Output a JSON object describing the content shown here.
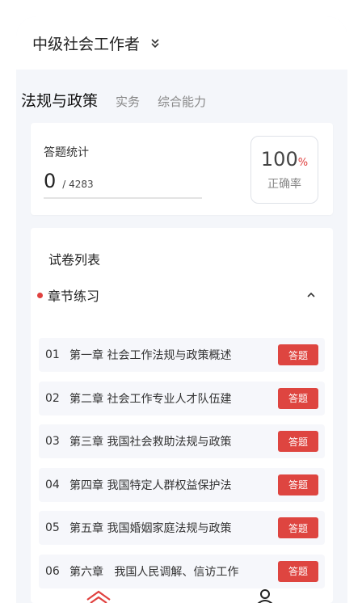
{
  "header": {
    "title": "中级社会工作者"
  },
  "tabs": [
    {
      "label": "法规与政策",
      "active": true
    },
    {
      "label": "实务",
      "active": false
    },
    {
      "label": "综合能力",
      "active": false
    }
  ],
  "stats": {
    "label": "答题统计",
    "answered": "0",
    "total": "/ 4283",
    "accuracy_value": "100",
    "accuracy_symbol": "%",
    "accuracy_label": "正确率"
  },
  "list": {
    "title": "试卷列表",
    "section": "章节练习",
    "items": [
      {
        "no": "01",
        "text": "第一章 社会工作法规与政策概述",
        "button": "答题"
      },
      {
        "no": "02",
        "text": "第二章 社会工作专业人才队伍建",
        "button": "答题"
      },
      {
        "no": "03",
        "text": "第三章 我国社会救助法规与政策",
        "button": "答题"
      },
      {
        "no": "04",
        "text": "第四章 我国特定人群权益保护法",
        "button": "答题"
      },
      {
        "no": "05",
        "text": "第五章 我国婚姻家庭法规与政策",
        "button": "答题"
      },
      {
        "no": "06",
        "text": "第六章   我国人民调解、信访工作",
        "button": "答题"
      }
    ]
  },
  "colors": {
    "accent": "#de4540",
    "background": "#f4f6fa"
  },
  "icons": [
    "chevron-down-icon",
    "chevron-up-icon",
    "home-icon",
    "user-icon"
  ]
}
